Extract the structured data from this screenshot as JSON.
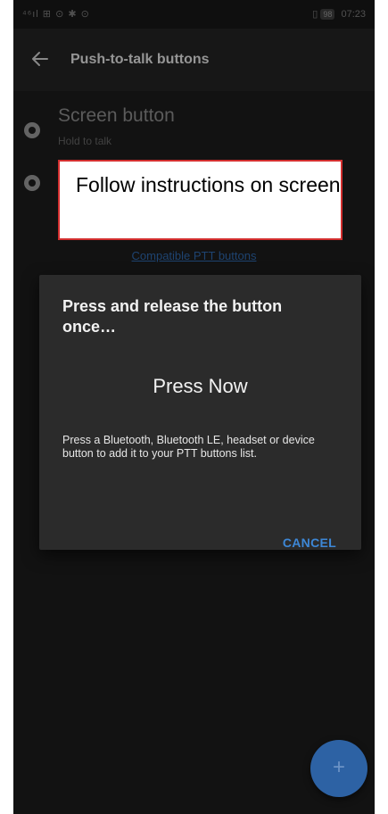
{
  "status_bar": {
    "left_icons": "⁴⁶ıl ⊞ ⊙ ✱ ⊙",
    "battery": "98",
    "time": "07:23"
  },
  "appbar": {
    "title": "Push-to-talk buttons",
    "back_icon": "arrow-left"
  },
  "rows": [
    {
      "title": "Screen button",
      "subtitle": "Hold to talk",
      "icon": "mic-circle-icon"
    },
    {
      "title": "",
      "subtitle": "",
      "icon": "waveform-circle-icon"
    }
  ],
  "compatible_link": "Compatible PTT buttons",
  "callout": {
    "text": "Follow instructions on screen"
  },
  "dialog": {
    "title": "Press and release the button once…",
    "press_now": "Press Now",
    "body": "Press a Bluetooth, Bluetooth LE, headset or device button to add it to your PTT buttons list.",
    "cancel": "CANCEL"
  },
  "fab": {
    "icon": "plus-icon",
    "label": "+"
  },
  "colors": {
    "background": "#191919",
    "accent": "#3d87d6",
    "fab": "#2d62a4",
    "callout_border": "#d32f2f"
  }
}
